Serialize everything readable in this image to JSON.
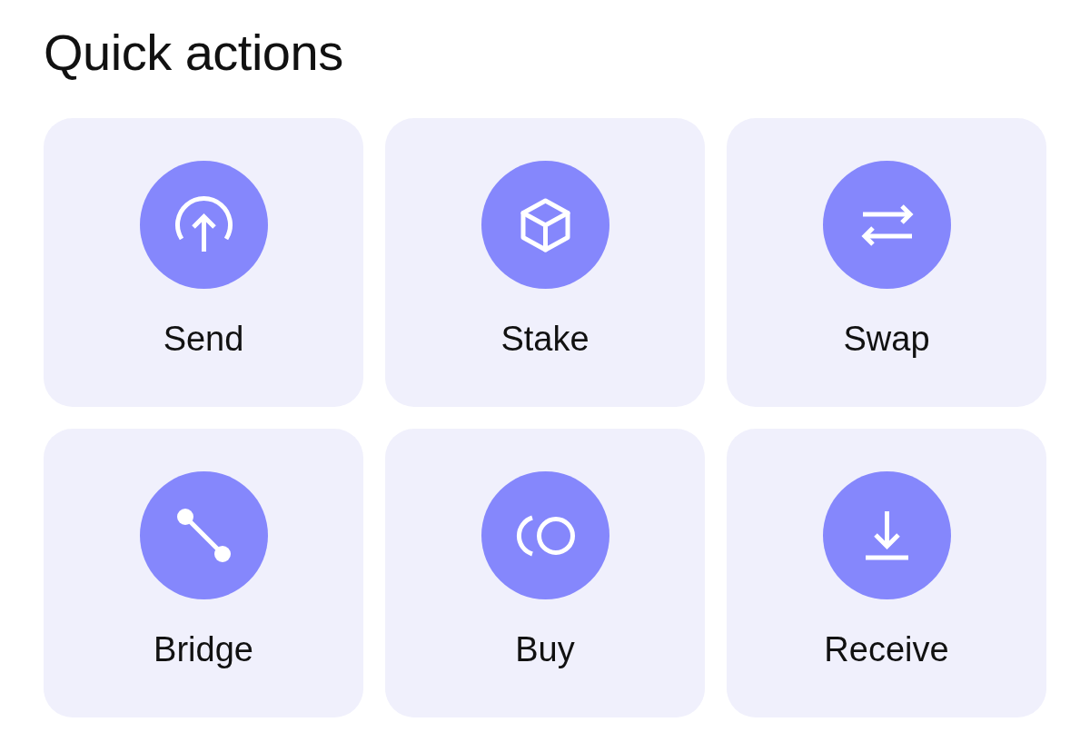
{
  "title": "Quick actions",
  "actions": [
    {
      "label": "Send",
      "kind": "send"
    },
    {
      "label": "Stake",
      "kind": "stake"
    },
    {
      "label": "Swap",
      "kind": "swap"
    },
    {
      "label": "Bridge",
      "kind": "bridge"
    },
    {
      "label": "Buy",
      "kind": "buy"
    },
    {
      "label": "Receive",
      "kind": "receive"
    }
  ]
}
